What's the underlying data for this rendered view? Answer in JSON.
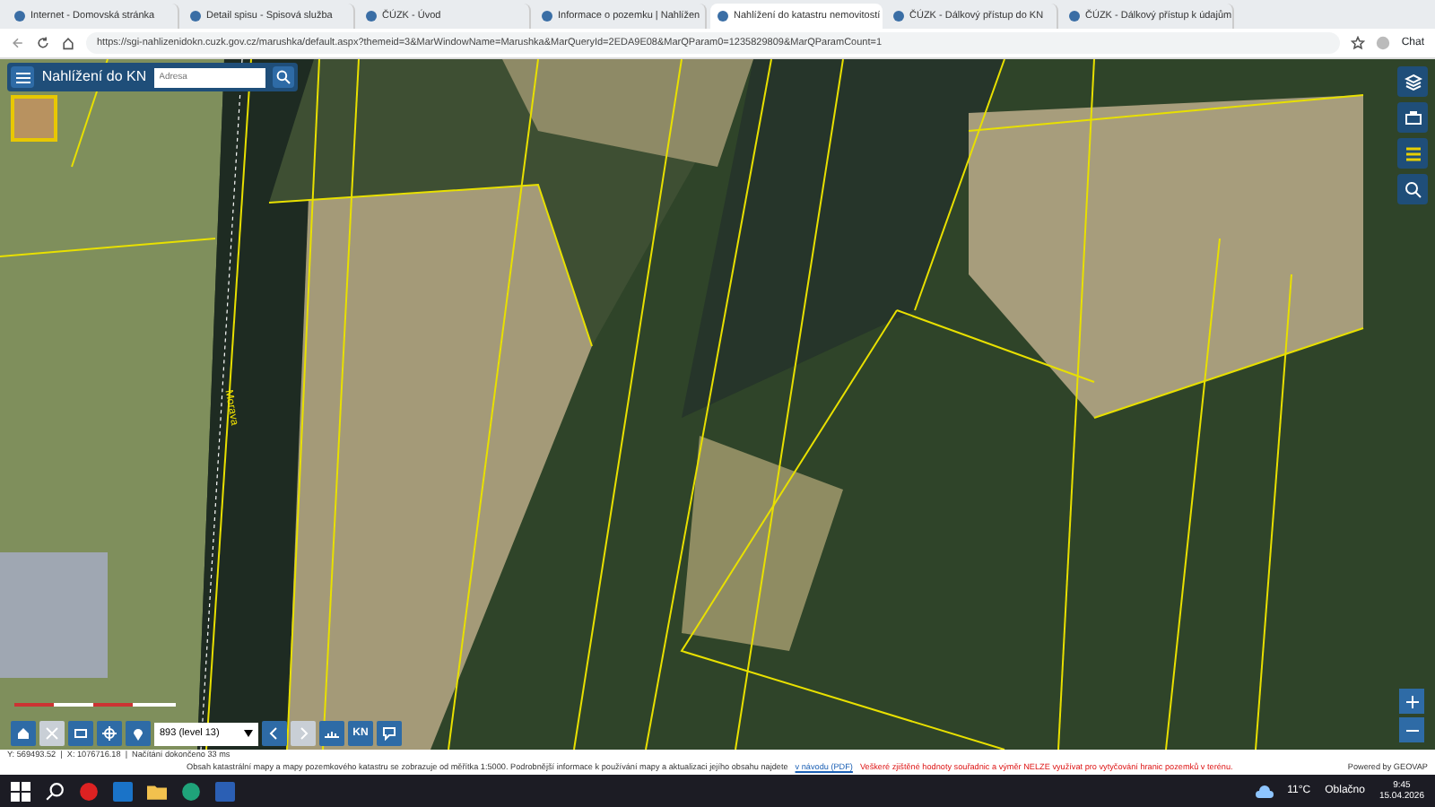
{
  "browser": {
    "tabs": [
      {
        "title": "Internet - Domovská stránka",
        "selected": false
      },
      {
        "title": "Detail spisu - Spisová služba",
        "selected": false
      },
      {
        "title": "ČÚZK - Úvod",
        "selected": false
      },
      {
        "title": "Informace o pozemku | Nahlížen",
        "selected": false
      },
      {
        "title": "Nahlížení do katastru nemovitostí",
        "selected": true
      },
      {
        "title": "ČÚZK - Dálkový přístup do KN",
        "selected": false
      },
      {
        "title": "ČÚZK - Dálkový přístup k údajům",
        "selected": false
      }
    ],
    "url": "https://sgi-nahlizenidokn.cuzk.gov.cz/marushka/default.aspx?themeid=3&MarWindowName=Marushka&MarQueryId=2EDA9E08&MarQParam0=1235829809&MarQParamCount=1",
    "chat_label": "Chat"
  },
  "app": {
    "title": "Nahlížení do KN",
    "search": {
      "placeholder": "Adresa"
    },
    "map_label": "Morava",
    "scale_select": "893 (level 13)",
    "kn_button": "KN"
  },
  "status": {
    "coordinates": "Y: 569493.52  |  X: 1076716.18  |  Načítání dokončeno 33 ms",
    "notice": "Obsah katastrální mapy a mapy pozemkového katastru se zobrazuje od měřítka 1:5000. Podrobnější informace k používání mapy a aktualizaci jejího obsahu najdete",
    "notice_link": "v návodu (PDF)",
    "warning": "Veškeré zjištěné hodnoty souřadnic a výměr NELZE využívat pro vytyčování hranic pozemků v terénu.",
    "powered_by": "Powered by GEOVAP"
  },
  "taskbar": {
    "temperature": "11°C",
    "condition": "Oblačno",
    "time": "9:45",
    "date": "15.04.2026"
  }
}
